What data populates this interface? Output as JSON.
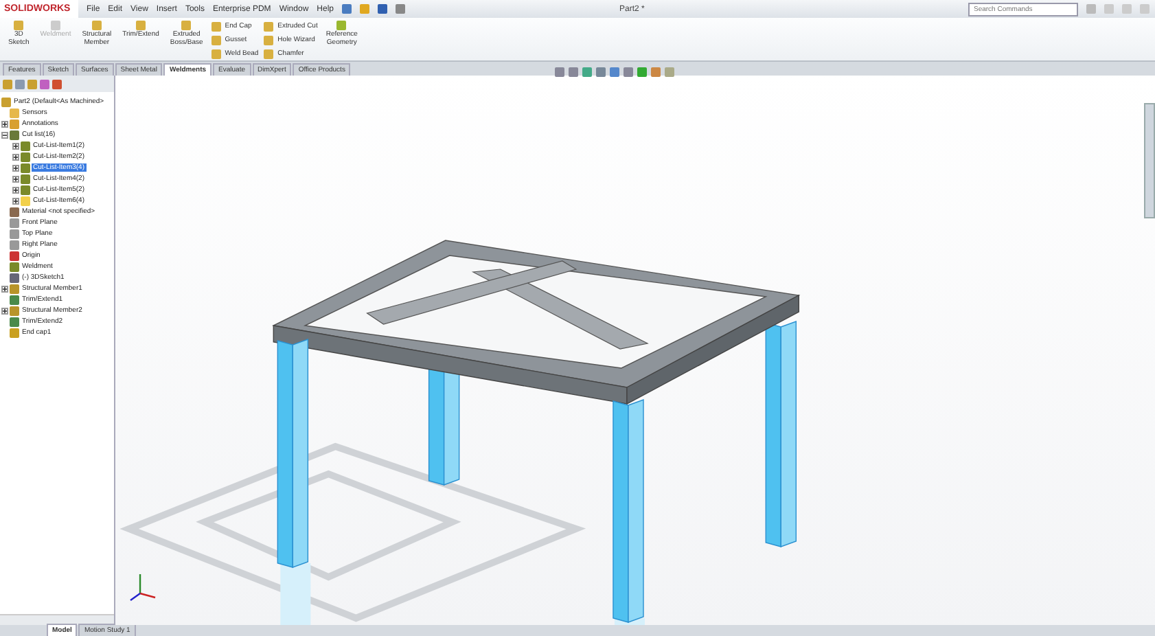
{
  "app": {
    "logo": "SOLIDWORKS",
    "title": "Part2 *",
    "search": {
      "placeholder": "Search Commands"
    }
  },
  "menu": [
    "File",
    "Edit",
    "View",
    "Insert",
    "Tools",
    "Enterprise PDM",
    "Window",
    "Help"
  ],
  "ribbon": {
    "large": [
      {
        "label": "3D\nSketch",
        "disabled": false
      },
      {
        "label": "Weldment",
        "disabled": true
      },
      {
        "label": "Structural\nMember",
        "disabled": false
      },
      {
        "label": "Trim/Extend",
        "disabled": false
      },
      {
        "label": "Extruded\nBoss/Base",
        "disabled": false
      }
    ],
    "columns": [
      [
        "End Cap",
        "Gusset",
        "Weld Bead"
      ],
      [
        "Extruded Cut",
        "Hole Wizard",
        "Chamfer"
      ]
    ],
    "last": {
      "label": "Reference\nGeometry",
      "disabled": false
    }
  },
  "tabs": [
    {
      "label": "Features",
      "selected": false
    },
    {
      "label": "Sketch",
      "selected": false
    },
    {
      "label": "Surfaces",
      "selected": false
    },
    {
      "label": "Sheet Metal",
      "selected": false
    },
    {
      "label": "Weldments",
      "selected": true
    },
    {
      "label": "Evaluate",
      "selected": false
    },
    {
      "label": "DimXpert",
      "selected": false
    },
    {
      "label": "Office Products",
      "selected": false
    }
  ],
  "tree": {
    "root": "Part2  (Default<As Machined>",
    "items": [
      {
        "label": "Sensors",
        "kind": "sensor"
      },
      {
        "label": "Annotations",
        "kind": "annotation",
        "expanded": false
      },
      {
        "label": "Cut list(16)",
        "kind": "cutlist",
        "expanded": true,
        "children": [
          {
            "label": "Cut-List-Item1(2)",
            "kind": "member",
            "expanded": false,
            "selected": false
          },
          {
            "label": "Cut-List-Item2(2)",
            "kind": "member",
            "expanded": false,
            "selected": false
          },
          {
            "label": "Cut-List-Item3(4)",
            "kind": "member",
            "expanded": false,
            "selected": true
          },
          {
            "label": "Cut-List-Item4(2)",
            "kind": "member",
            "expanded": false,
            "selected": false
          },
          {
            "label": "Cut-List-Item5(2)",
            "kind": "member",
            "expanded": false,
            "selected": false
          },
          {
            "label": "Cut-List-Item6(4)",
            "kind": "folder",
            "expanded": false,
            "selected": false
          }
        ]
      },
      {
        "label": "Material <not specified>",
        "kind": "material"
      },
      {
        "label": "Front Plane",
        "kind": "plane"
      },
      {
        "label": "Top Plane",
        "kind": "plane"
      },
      {
        "label": "Right Plane",
        "kind": "plane"
      },
      {
        "label": "Origin",
        "kind": "origin"
      },
      {
        "label": "Weldment",
        "kind": "member"
      },
      {
        "label": "(-) 3DSketch1",
        "kind": "sketch"
      },
      {
        "label": "Structural Member1",
        "kind": "feature",
        "expanded": false
      },
      {
        "label": "Trim/Extend1",
        "kind": "trim"
      },
      {
        "label": "Structural Member2",
        "kind": "feature",
        "expanded": false
      },
      {
        "label": "Trim/Extend2",
        "kind": "trim"
      },
      {
        "label": "End cap1",
        "kind": "endcap"
      }
    ]
  },
  "bottom_tabs": [
    {
      "label": "Model",
      "selected": true
    },
    {
      "label": "Motion Study 1",
      "selected": false
    }
  ]
}
